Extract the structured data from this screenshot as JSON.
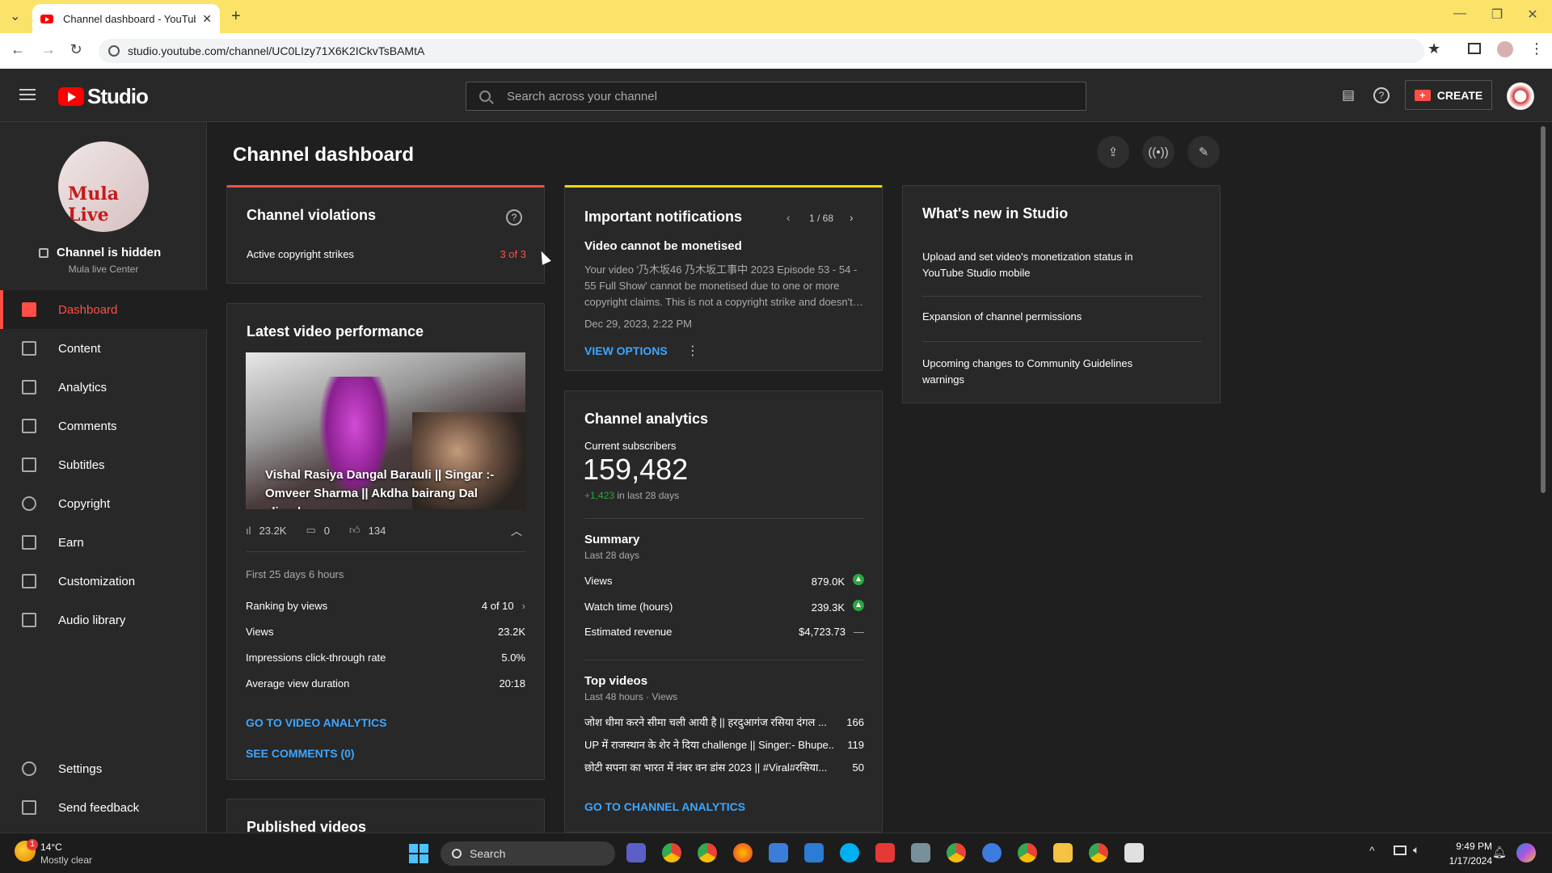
{
  "browser": {
    "tab_title": "Channel dashboard - YouTube",
    "url": "studio.youtube.com/channel/UC0LIzy71X6K2ICkvTsBAMtA"
  },
  "header": {
    "logo_text": "Studio",
    "search_placeholder": "Search across your channel",
    "create_label": "CREATE"
  },
  "sidebar": {
    "channel_status": "Channel is hidden",
    "channel_name": "Mula live Center",
    "avatar_text": "Mula Live",
    "items": [
      {
        "label": "Dashboard"
      },
      {
        "label": "Content"
      },
      {
        "label": "Analytics"
      },
      {
        "label": "Comments"
      },
      {
        "label": "Subtitles"
      },
      {
        "label": "Copyright"
      },
      {
        "label": "Earn"
      },
      {
        "label": "Customization"
      },
      {
        "label": "Audio library"
      }
    ],
    "bottom_items": [
      {
        "label": "Settings"
      },
      {
        "label": "Send feedback"
      }
    ]
  },
  "page": {
    "title": "Channel dashboard"
  },
  "violations": {
    "title": "Channel violations",
    "label": "Active copyright strikes",
    "value": "3 of 3"
  },
  "notifications": {
    "title": "Important notifications",
    "pager": "1 / 68",
    "heading": "Video cannot be monetised",
    "body": "Your video '乃木坂46 乃木坂工事中 2023 Episode 53 - 54 - 55 Full Show' cannot be monetised due to one or more copyright claims. This is not a copyright strike and doesn't…",
    "date": "Dec 29, 2023, 2:22 PM",
    "action": "VIEW OPTIONS"
  },
  "latest": {
    "title": "Latest video performance",
    "video_title": "Vishal Rasiya Dangal Barauli || Singar :- Omveer Sharma || Akdha bairang Dal aligarh",
    "views": "23.2K",
    "comments": "0",
    "likes": "134",
    "period": "First 25 days 6 hours",
    "rows": [
      {
        "label": "Ranking by views",
        "value": "4 of 10"
      },
      {
        "label": "Views",
        "value": "23.2K"
      },
      {
        "label": "Impressions click-through rate",
        "value": "5.0%"
      },
      {
        "label": "Average view duration",
        "value": "20:18"
      }
    ],
    "link1": "GO TO VIDEO ANALYTICS",
    "link2": "SEE COMMENTS (0)"
  },
  "analytics": {
    "title": "Channel analytics",
    "subs_label": "Current subscribers",
    "subs_value": "159,482",
    "subs_delta": "+1,423",
    "subs_delta_suffix": "in last 28 days",
    "summary_title": "Summary",
    "summary_period": "Last 28 days",
    "summary": [
      {
        "label": "Views",
        "value": "879.0K"
      },
      {
        "label": "Watch time (hours)",
        "value": "239.3K"
      },
      {
        "label": "Estimated revenue",
        "value": "$4,723.73"
      }
    ],
    "dash": "—",
    "top_title": "Top videos",
    "top_period": "Last 48 hours · Views",
    "top_videos": [
      {
        "title": "जोश धीमा करने सीमा चली आयी है || हरदुआगंज रसिया दंगल ...",
        "views": "166"
      },
      {
        "title": "UP में राजस्थान के शेर ने दिया challenge || Singer:- Bhupe...",
        "views": "119"
      },
      {
        "title": "छोटी सपना का भारत में नंबर वन डांस 2023 || #Viral#रसिया...",
        "views": "50"
      }
    ],
    "link": "GO TO CHANNEL ANALYTICS"
  },
  "whatsnew": {
    "title": "What's new in Studio",
    "items": [
      "Upload and set video's monetization status in YouTube Studio mobile",
      "Expansion of channel permissions",
      "Upcoming changes to Community Guidelines warnings"
    ]
  },
  "published": {
    "title": "Published videos"
  },
  "taskbar": {
    "temp": "14°C",
    "weather": "Mostly clear",
    "search": "Search",
    "time": "9:49 PM",
    "date": "1/17/2024",
    "badge": "1"
  }
}
